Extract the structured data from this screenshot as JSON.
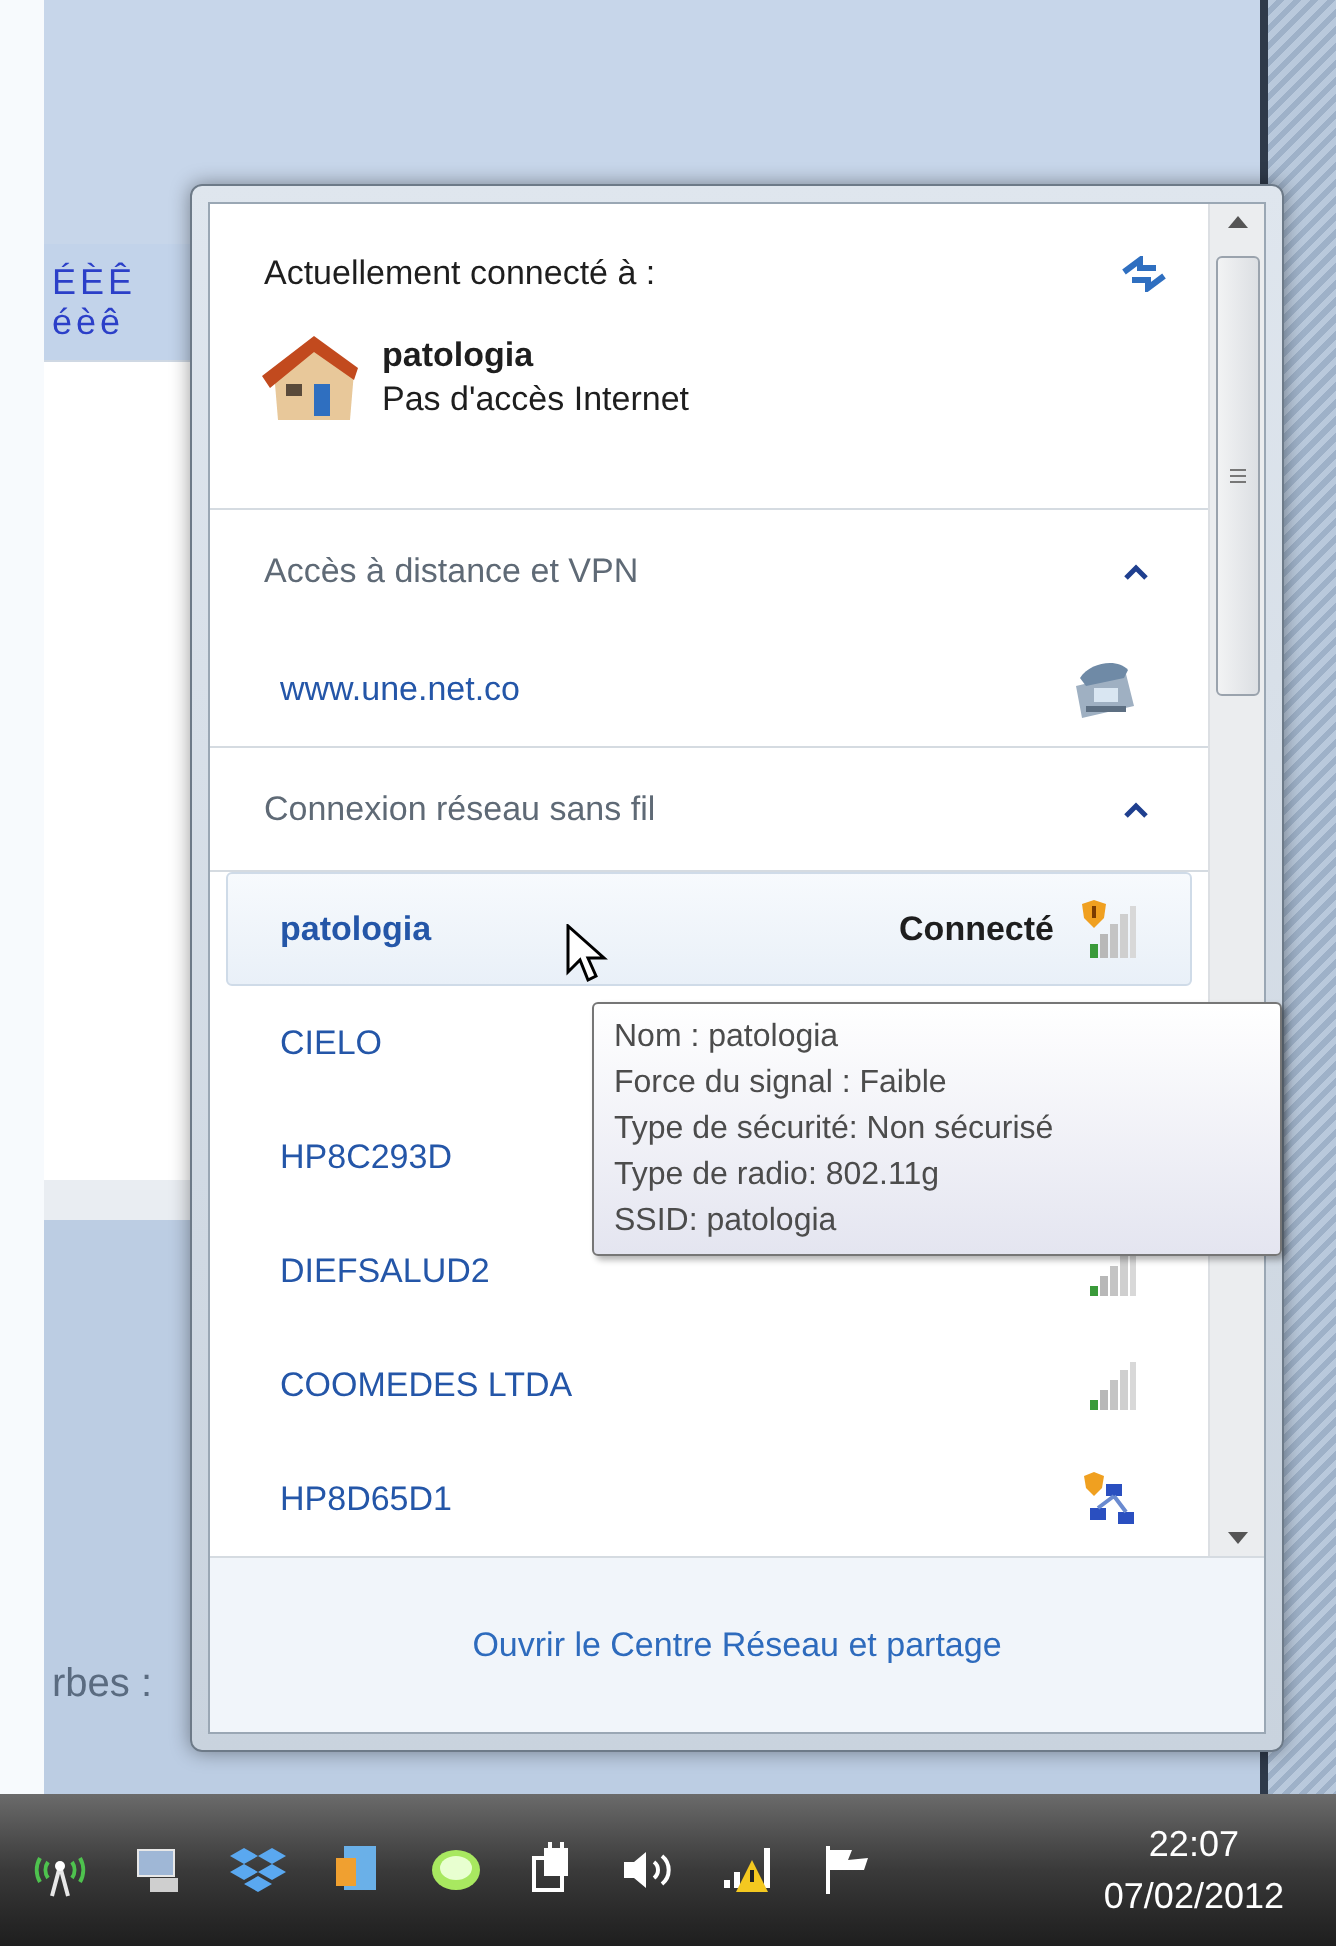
{
  "background": {
    "accent_upper": "ÉÈÊ",
    "accent_lower": "éèê",
    "partial_label": "rbes :"
  },
  "flyout": {
    "heading": "Actuellement connecté à :",
    "current": {
      "name": "patologia",
      "status": "Pas d'accès Internet"
    },
    "sections": [
      {
        "title": "Accès à distance et VPN",
        "expanded": true,
        "items": [
          {
            "kind": "dialup",
            "name": "www.une.net.co"
          }
        ]
      },
      {
        "title": "Connexion réseau sans fil",
        "expanded": true,
        "items": [
          {
            "kind": "shield",
            "name": "patologia",
            "status": "Connecté",
            "selected": true
          },
          {
            "name": "CIELO",
            "selected": false
          },
          {
            "name": "HP8C293D",
            "selected": false
          },
          {
            "kind": "open",
            "name": "DIEFSALUD2",
            "selected": false
          },
          {
            "kind": "open",
            "name": "COOMEDES LTDA",
            "selected": false
          },
          {
            "kind": "adhoc",
            "name": "HP8D65D1",
            "selected": false
          }
        ]
      }
    ],
    "footer_link": "Ouvrir le Centre Réseau et partage"
  },
  "tooltip": [
    "Nom : patologia",
    "Force du signal : Faible",
    "Type de sécurité: Non sécurisé",
    "Type de radio: 802.11g",
    "SSID: patologia"
  ],
  "clock": {
    "time": "22:07",
    "date": "07/02/2012"
  }
}
